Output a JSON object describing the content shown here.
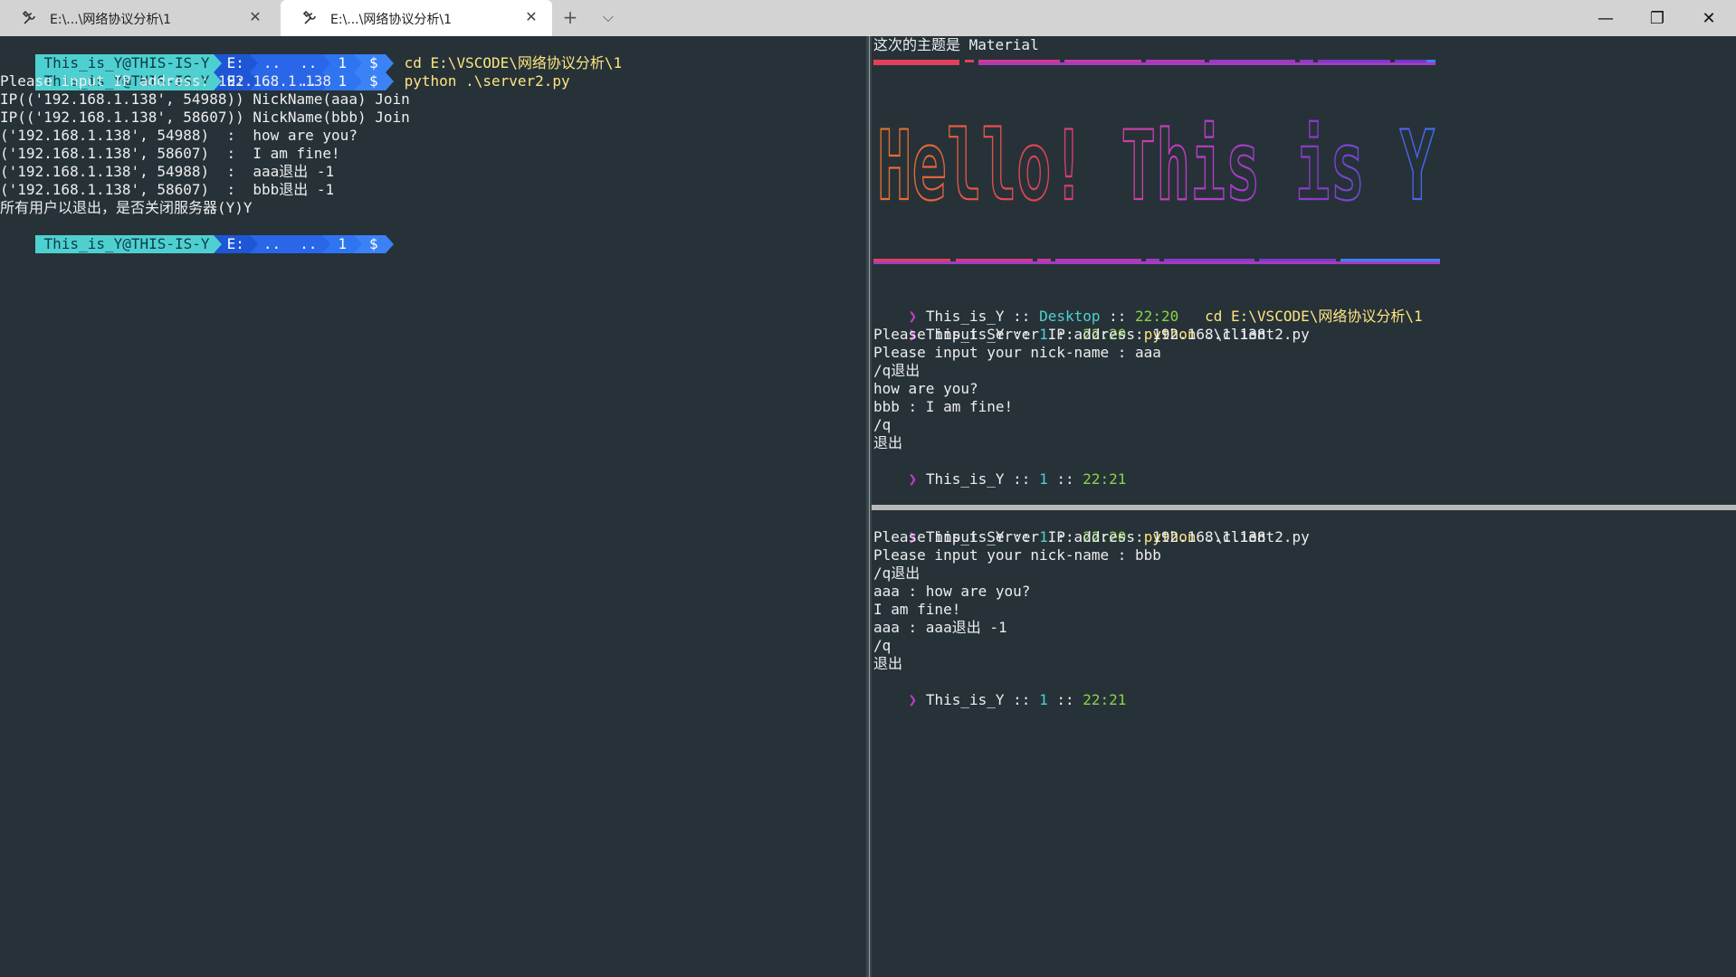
{
  "tabs": [
    {
      "label": "E:\\...\\网络协议分析\\1"
    },
    {
      "label": "E:\\...\\网络协议分析\\1"
    }
  ],
  "toolbar": {
    "new_tab": "+",
    "dropdown": "⌵"
  },
  "window_controls": {
    "minimize": "—",
    "restore": "❐",
    "close": "✕"
  },
  "left_pane": {
    "prompt": {
      "user": "This_is_Y@THIS-IS-Y",
      "drive": "E:",
      "dir1": "..",
      "dir2": "..",
      "dir3": "1",
      "dollar": "$"
    },
    "commands": [
      "cd E:\\VSCODE\\网络协议分析\\1",
      "python .\\server2.py"
    ],
    "output": [
      "Please input IP address: 192.168.1.138",
      "IP(('192.168.1.138', 54988)) NickName(aaa) Join",
      "IP(('192.168.1.138', 58607)) NickName(bbb) Join",
      "('192.168.1.138', 54988)  :  how are you?",
      "('192.168.1.138', 58607)  :  I am fine!",
      "('192.168.1.138', 54988)  :  aaa退出 -1",
      "('192.168.1.138', 58607)  :  bbb退出 -1",
      "所有用户以退出，是否关闭服务器(Y)Y"
    ]
  },
  "right_top": {
    "theme_line": "这次的主题是 Material",
    "banner": "Hello! This is Y",
    "prompt_user": "This_is_Y",
    "sep": "::",
    "lines": [
      {
        "dir": "Desktop",
        "time": "22:20",
        "cmd_kw": "",
        "cmd": "cd E:\\VSCODE\\网络协议分析\\1"
      },
      {
        "dir": "1",
        "time": "22:20",
        "cmd_kw": "python",
        "cmd": ".\\client2.py"
      }
    ],
    "output": [
      "Please input Server IP address: 192.168.1.138",
      "Please input your nick-name : aaa",
      "/q退出",
      "how are you?",
      "bbb : I am fine!",
      "/q",
      "退出"
    ],
    "final_prompt": {
      "dir": "1",
      "time": "22:21"
    }
  },
  "right_bottom": {
    "prompt_user": "This_is_Y",
    "sep": "::",
    "first": {
      "dir": "1",
      "time": "22:20",
      "cmd_kw": "python",
      "cmd": ".\\client2.py"
    },
    "output": [
      "Please input Server IP address: 192.168.1.138",
      "Please input your nick-name : bbb",
      "/q退出",
      "aaa : how are you?",
      "I am fine!",
      "aaa : aaa退出 -1",
      "/q",
      "退出"
    ],
    "final_prompt": {
      "dir": "1",
      "time": "22:21"
    }
  },
  "colors": {
    "background": "#263238",
    "cyan": "#4fd0d0",
    "blue": "#2966e8",
    "yellow": "#ffe57f",
    "green": "#8bd448",
    "magenta": "#c13cc7"
  },
  "icons": {
    "tab_icon": "tools-icon",
    "close": "close-icon"
  }
}
